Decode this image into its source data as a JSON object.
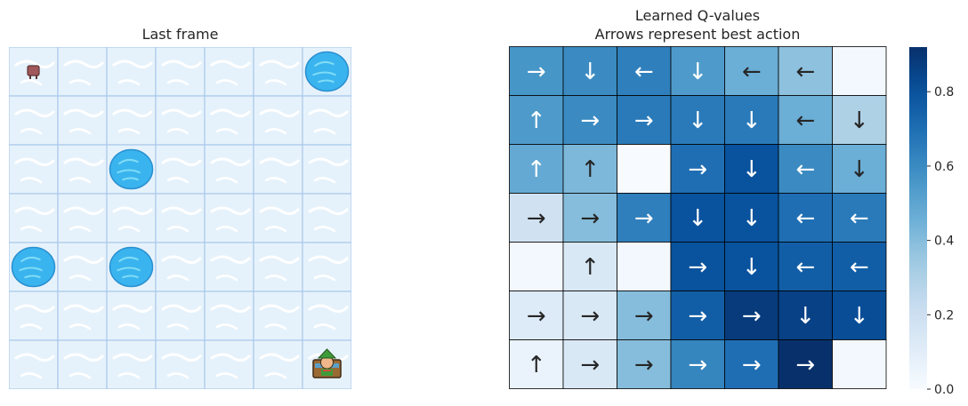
{
  "left_panel": {
    "title": "Last frame",
    "grid_size": 7,
    "holes": [
      [
        0,
        6
      ],
      [
        2,
        2
      ],
      [
        4,
        0
      ],
      [
        4,
        2
      ]
    ],
    "player": [
      6,
      6
    ],
    "start": [
      0,
      0
    ],
    "colors": {
      "ice": "#e6f2fb",
      "ice_streak": "#ffffff",
      "grid_line": "#a9c9ec",
      "hole": "#3ab4ee",
      "hole_light": "#7fdcf6"
    }
  },
  "right_panel": {
    "title_line1": "Learned Q-values",
    "title_line2": "Arrows represent best action"
  },
  "chart_data": {
    "type": "heatmap",
    "title": "Learned Q-values\nArrows represent best action",
    "rows": 7,
    "cols": 7,
    "values": [
      [
        0.56,
        0.6,
        0.64,
        0.54,
        0.46,
        0.38,
        0.02
      ],
      [
        0.54,
        0.6,
        0.66,
        0.66,
        0.66,
        0.46,
        0.3
      ],
      [
        0.48,
        0.42,
        0.0,
        0.7,
        0.8,
        0.6,
        0.46
      ],
      [
        0.18,
        0.4,
        0.64,
        0.8,
        0.8,
        0.7,
        0.66
      ],
      [
        0.02,
        0.14,
        0.02,
        0.8,
        0.8,
        0.76,
        0.76
      ],
      [
        0.12,
        0.14,
        0.4,
        0.76,
        0.88,
        0.86,
        0.82
      ],
      [
        0.06,
        0.14,
        0.4,
        0.62,
        0.7,
        0.92,
        0.02
      ]
    ],
    "arrows": [
      [
        "→",
        "↓",
        "←",
        "↓",
        "←",
        "←",
        ""
      ],
      [
        "↑",
        "→",
        "→",
        "↓",
        "↓",
        "←",
        "↓"
      ],
      [
        "↑",
        "↑",
        "",
        "→",
        "↓",
        "←",
        "↓"
      ],
      [
        "→",
        "→",
        "→",
        "↓",
        "↓",
        "←",
        "←"
      ],
      [
        "",
        "↑",
        "",
        "→",
        "↓",
        "←",
        "←"
      ],
      [
        "→",
        "→",
        "→",
        "→",
        "→",
        "↓",
        "↓"
      ],
      [
        "↑",
        "→",
        "→",
        "→",
        "→",
        "→",
        ""
      ]
    ],
    "colorbar": {
      "min": 0.0,
      "max": 0.92,
      "ticks": [
        "0.0",
        "0.2",
        "0.4",
        "0.6",
        "0.8"
      ],
      "tick_values": [
        0.0,
        0.2,
        0.4,
        0.6,
        0.8
      ]
    },
    "colormap": "Blues",
    "arrow_color_dark": "#262626",
    "arrow_color_light": "#ffffff"
  }
}
